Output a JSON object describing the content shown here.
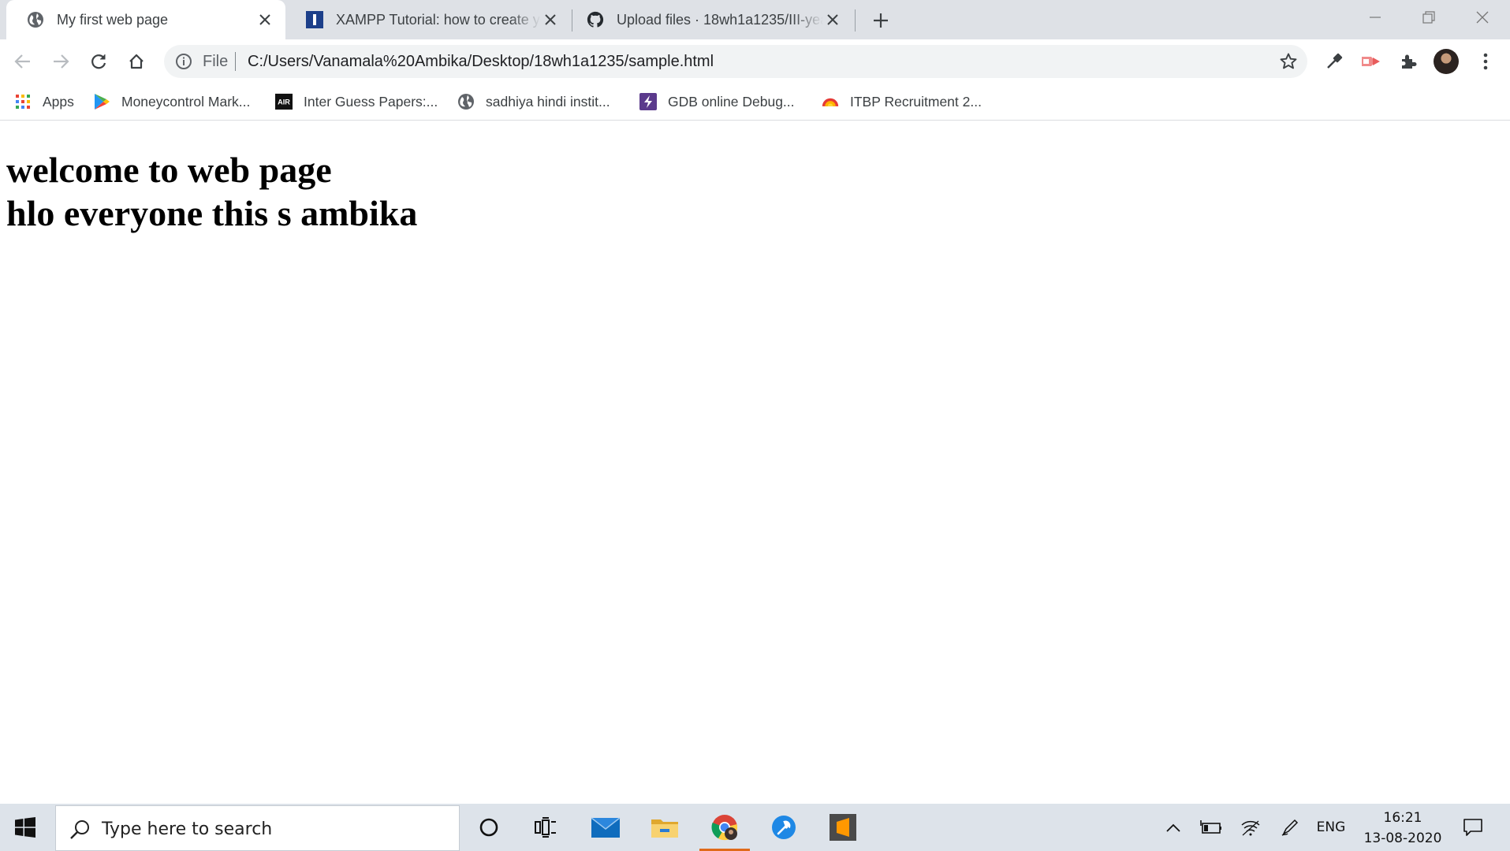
{
  "browser": {
    "tabs": [
      {
        "title": "My first web page",
        "favicon": "globe-icon",
        "active": true
      },
      {
        "title": "XAMPP Tutorial: how to create your",
        "favicon": "blog-favicon-icon",
        "active": false
      },
      {
        "title": "Upload files · 18wh1a1235/III-year",
        "favicon": "github-icon",
        "active": false
      }
    ],
    "omnibox": {
      "scheme_label": "File",
      "url": "C:/Users/Vanamala%20Ambika/Desktop/18wh1a1235/sample.html"
    },
    "bookmarks": [
      {
        "label": "Apps",
        "icon": "apps-grid-icon"
      },
      {
        "label": "Moneycontrol Mark...",
        "icon": "play-store-icon"
      },
      {
        "label": "Inter Guess Papers:...",
        "icon": "air-icon"
      },
      {
        "label": "sadhiya hindi instit...",
        "icon": "globe-icon"
      },
      {
        "label": "GDB online Debug...",
        "icon": "gdb-icon"
      },
      {
        "label": "ITBP Recruitment 2...",
        "icon": "sunrise-icon"
      }
    ],
    "air_badge": "AIR"
  },
  "page": {
    "heading1": "welcome to web page",
    "heading2": "hlo everyone this s ambika"
  },
  "taskbar": {
    "search_placeholder": "Type here to search",
    "language": "ENG",
    "time": "16:21",
    "date": "13-08-2020"
  },
  "colors": {
    "tabstrip": "#dee1e6",
    "omnibox": "#f1f3f4",
    "taskbar": "#dde3ea",
    "chrome_active_indicator": "#e06a1a"
  }
}
